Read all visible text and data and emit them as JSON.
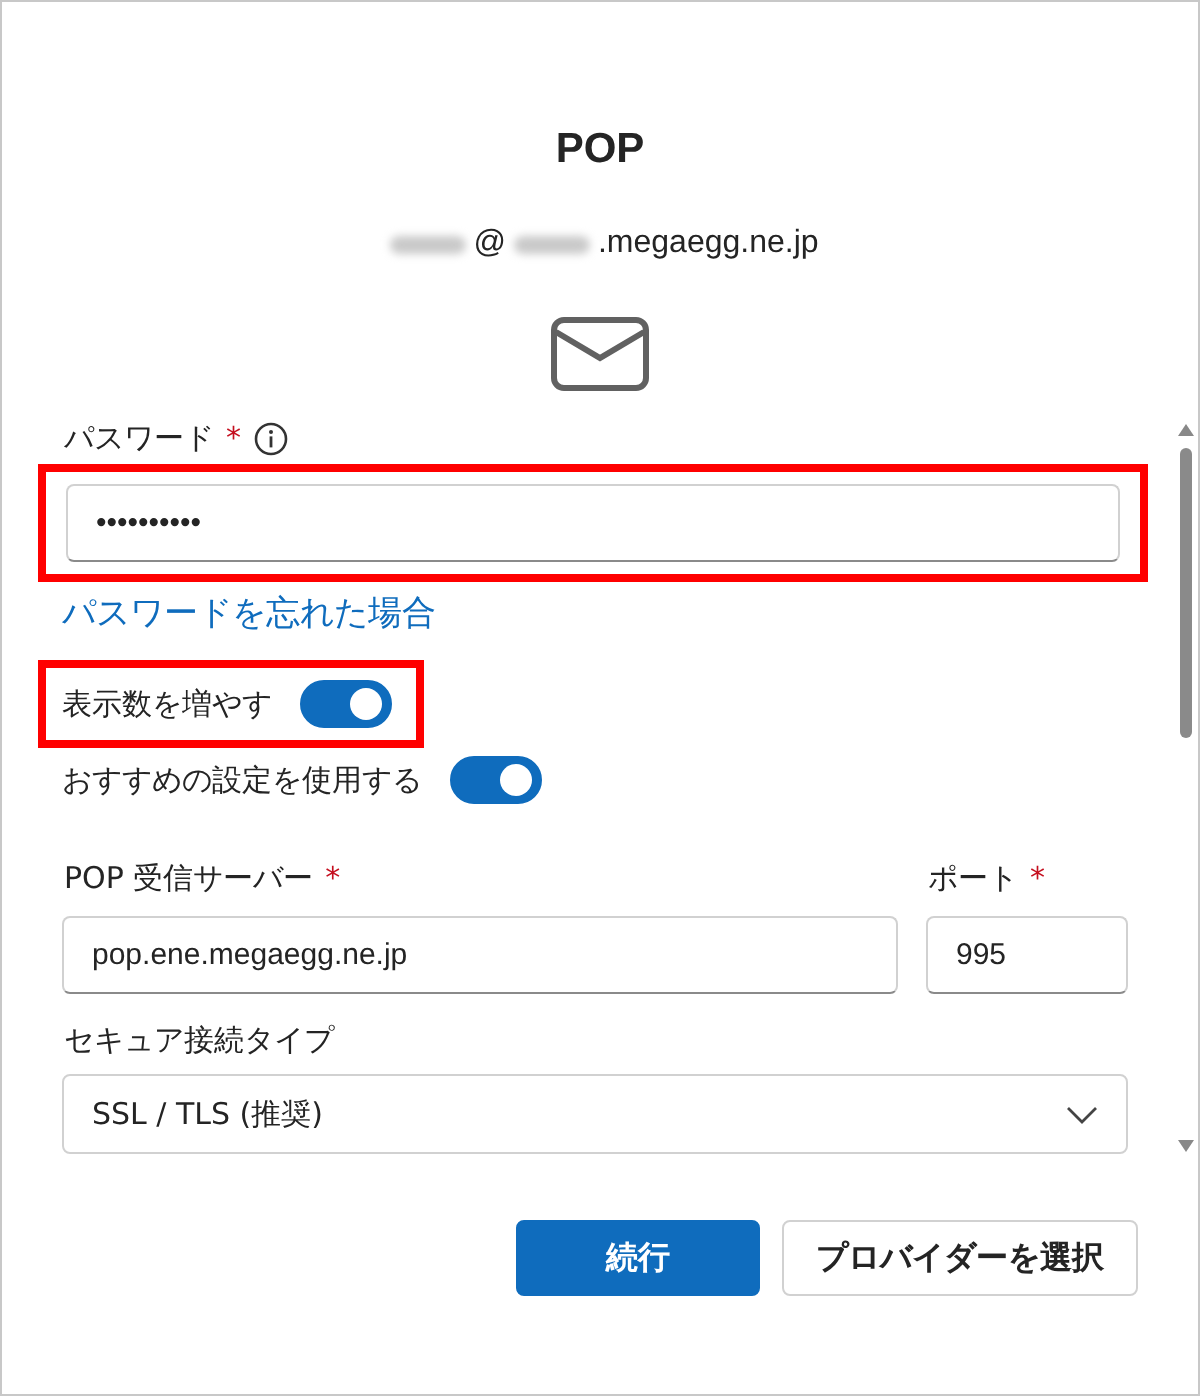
{
  "title": "POP",
  "account": [
    {
      "kind": "blurred"
    },
    {
      "kind": "text",
      "text": "@"
    },
    {
      "kind": "blurred"
    },
    {
      "kind": "text",
      "text": ".megaegg.ne.jp"
    }
  ],
  "password": {
    "label": "パスワード",
    "required_mark": "*",
    "value": "••••••••••",
    "highlighted": true
  },
  "forgot_link": "パスワードを忘れた場合",
  "toggles": [
    {
      "label": "表示数を増やす",
      "on": true,
      "highlighted": true
    },
    {
      "label": "おすすめの設定を使用する",
      "on": true,
      "highlighted": false
    }
  ],
  "server": {
    "label": "POP 受信サーバー",
    "required_mark": "*",
    "value": "pop.ene.megaegg.ne.jp"
  },
  "port": {
    "label": "ポート",
    "required_mark": "*",
    "value": "995"
  },
  "security": {
    "label": "セキュア接続タイプ",
    "value": "SSL / TLS (推奨)"
  },
  "buttons": [
    {
      "label": "続行",
      "kind": "primary"
    },
    {
      "label": "プロバイダーを選択",
      "kind": "secondary"
    }
  ]
}
